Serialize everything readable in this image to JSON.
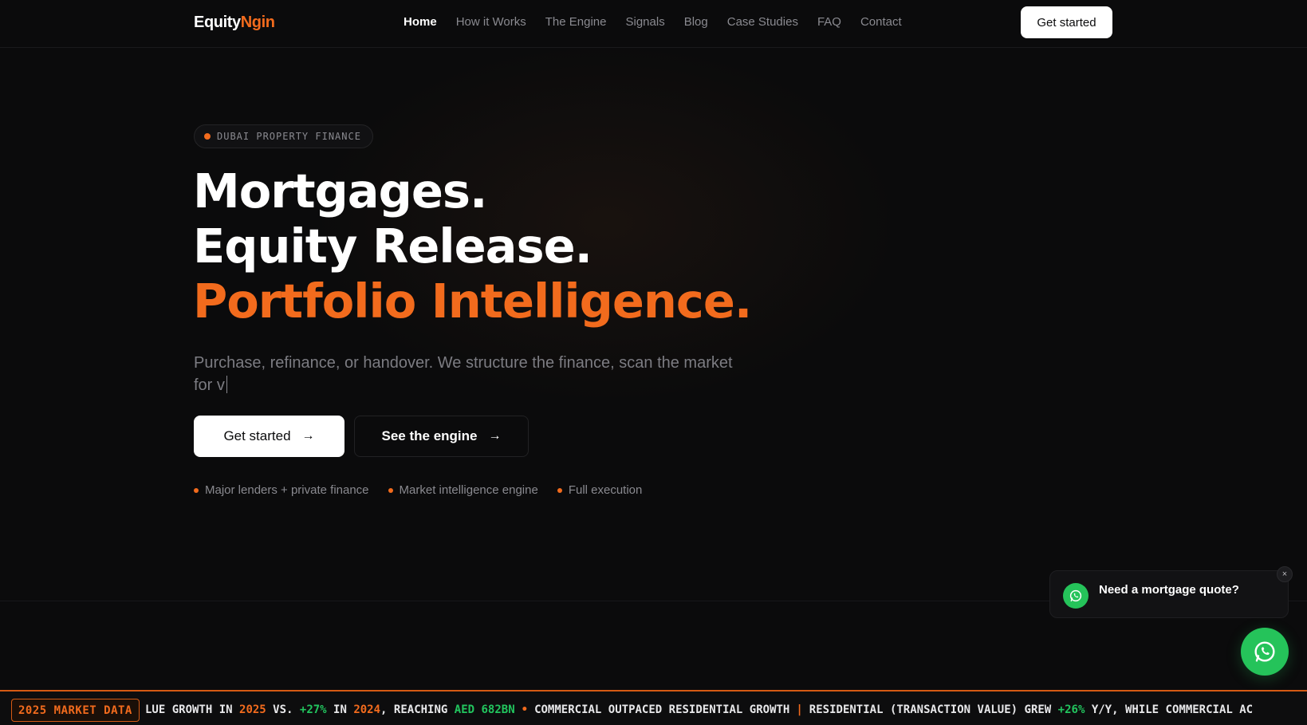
{
  "brand": {
    "part1": "Equity",
    "part2": "Ngin"
  },
  "nav": {
    "items": [
      "Home",
      "How it Works",
      "The Engine",
      "Signals",
      "Blog",
      "Case Studies",
      "FAQ",
      "Contact"
    ],
    "active": "Home",
    "cta": "Get started"
  },
  "hero": {
    "badge": "DUBAI PROPERTY FINANCE",
    "line1": "Mortgages.",
    "line2": "Equity Release.",
    "line3": "Portfolio Intelligence.",
    "subtitle": "Purchase, refinance, or handover. We structure the finance, scan the market for v",
    "primary_cta": "Get started",
    "secondary_cta": "See the engine",
    "features": [
      "Major lenders + private finance",
      "Market intelligence engine",
      "Full execution"
    ]
  },
  "chat": {
    "prompt": "Need a mortgage quote?",
    "close": "×"
  },
  "ticker": {
    "label": "2025 MARKET DATA",
    "seg1": "LUE GROWTH IN ",
    "seg2": "2025",
    "seg3": " VS. ",
    "seg4": "+27%",
    "seg5": " IN ",
    "seg6": "2024",
    "seg7": ", REACHING ",
    "seg8": "AED 682BN",
    "seg9": "•",
    "seg10": "COMMERCIAL OUTPACED RESIDENTIAL GROWTH",
    "seg11": "|",
    "seg12": "RESIDENTIAL (TRANSACTION VALUE) GREW ",
    "seg13": "+26%",
    "seg14": " Y/Y, WHILE COMMERCIAL AC"
  },
  "colors": {
    "accent": "#f26b1d",
    "whatsapp": "#25c35a",
    "positive": "#22c55e",
    "background": "#0b0b0c"
  }
}
